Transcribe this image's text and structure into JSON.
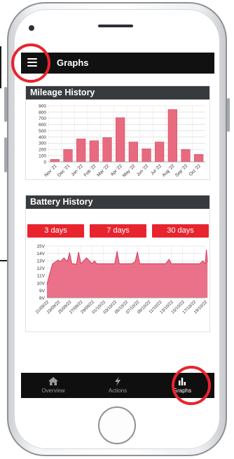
{
  "header": {
    "title": "Graphs",
    "menu_icon": "hamburger-icon"
  },
  "mileage": {
    "title": "Mileage History",
    "chart_data": {
      "type": "bar",
      "title": "Mileage History",
      "categories": [
        "Nov '21",
        "Dec '21",
        "Jan '22",
        "Feb '22",
        "Mar '22",
        "Apr '22",
        "May '22",
        "Jun '22",
        "Jul '22",
        "Aug '22",
        "Sep '22",
        "Oct '22"
      ],
      "values": [
        40,
        200,
        370,
        340,
        390,
        710,
        320,
        210,
        320,
        840,
        200,
        120
      ],
      "ylim": [
        0,
        900
      ],
      "yticks": [
        "0",
        "100",
        "200",
        "300",
        "400",
        "500",
        "600",
        "700",
        "800",
        "900"
      ],
      "bar_color": "#e86a7f",
      "grid": true
    }
  },
  "battery": {
    "title": "Battery History",
    "ranges": [
      "3 days",
      "7 days",
      "30 days"
    ],
    "chart_data": {
      "type": "area",
      "title": "Battery History",
      "yticks": [
        "8V",
        "9V",
        "10V",
        "11V",
        "12V",
        "13V",
        "14V",
        "15V"
      ],
      "ylim": [
        8,
        15
      ],
      "xticks": [
        "21/09/22",
        "23/09/22",
        "25/09/22",
        "27/09/22",
        "29/09/22",
        "01/10/22",
        "03/10/22",
        "05/10/22",
        "07/10/22",
        "09/10/22",
        "11/10/22",
        "13/10/22",
        "15/10/22",
        "17/10/22",
        "19/10/22"
      ],
      "x": [
        0,
        0.2,
        0.5,
        0.8,
        1.0,
        1.2,
        1.5,
        1.8,
        2.0,
        2.2,
        2.4,
        2.6,
        2.8,
        3.0,
        3.5,
        4.0,
        4.2,
        4.4,
        5.0,
        5.5,
        6.0,
        6.2,
        6.4,
        7.0,
        7.5,
        7.8,
        8.0,
        8.2,
        8.5,
        9.0,
        9.5,
        10.0,
        10.5,
        10.8,
        11.0,
        11.2,
        11.5,
        12.0,
        12.5,
        13.0,
        13.5,
        13.8,
        14.0,
        14.1,
        14.2
      ],
      "values": [
        9.8,
        11.0,
        12.6,
        12.9,
        13.1,
        12.9,
        13.4,
        12.9,
        14.1,
        12.6,
        12.6,
        12.5,
        14.2,
        12.6,
        13.4,
        12.6,
        13.0,
        12.6,
        12.6,
        12.6,
        12.6,
        14.3,
        12.6,
        12.6,
        12.6,
        12.9,
        14.2,
        12.6,
        12.6,
        12.6,
        12.6,
        12.6,
        12.6,
        13.2,
        12.6,
        12.6,
        12.6,
        12.6,
        12.6,
        12.6,
        12.6,
        13.0,
        12.6,
        14.5,
        12.8
      ],
      "fill_color": "#e8627c",
      "line_color": "#d93355",
      "grid": true
    }
  },
  "tabs": [
    {
      "label": "Overview",
      "icon": "home-icon"
    },
    {
      "label": "Actions",
      "icon": "lightning-icon"
    },
    {
      "label": "Graphs",
      "icon": "bar-chart-icon"
    }
  ],
  "colors": {
    "accent": "#e8242e",
    "bar": "#e86a7f",
    "header": "#373b3e",
    "topbar": "#111111"
  }
}
